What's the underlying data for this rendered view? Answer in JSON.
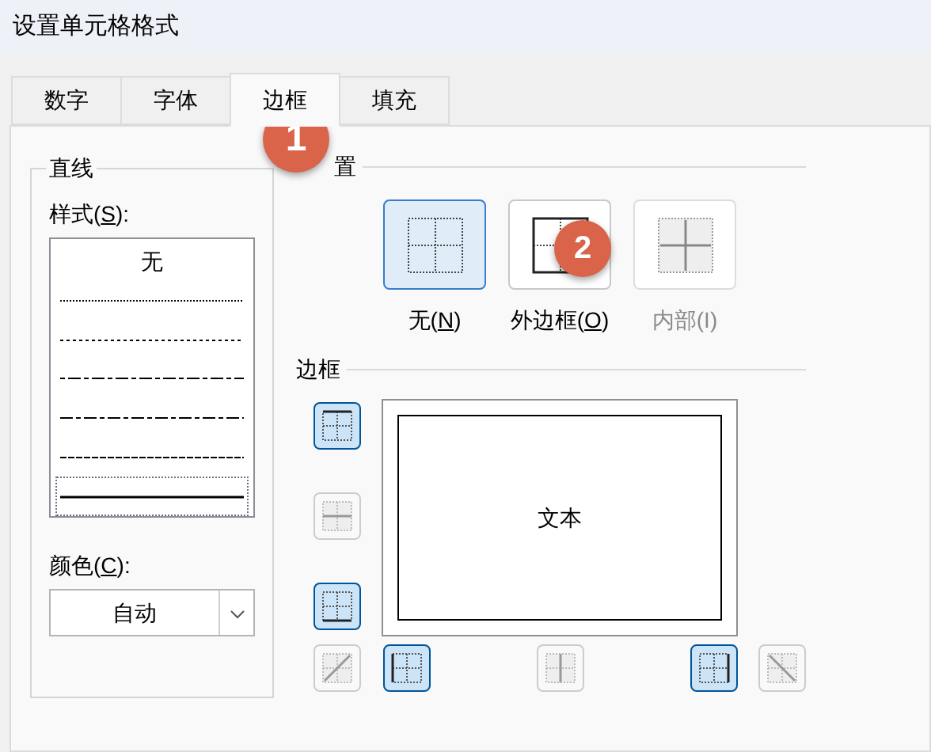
{
  "window": {
    "title": "设置单元格格式"
  },
  "tabs": [
    {
      "label": "数字",
      "selected": false
    },
    {
      "label": "字体",
      "selected": false
    },
    {
      "label": "边框",
      "selected": true
    },
    {
      "label": "填充",
      "selected": false
    }
  ],
  "line_group": {
    "legend": "直线",
    "style_label": {
      "before": "样式(",
      "key": "S",
      "after": "):"
    },
    "styles": [
      {
        "kind": "text",
        "label": "无",
        "selected": false
      },
      {
        "kind": "dotted",
        "selected": false
      },
      {
        "kind": "dashed-fine",
        "selected": false
      },
      {
        "kind": "dash-dot-dot",
        "selected": false
      },
      {
        "kind": "dash-dot",
        "selected": false
      },
      {
        "kind": "dashed",
        "selected": false
      },
      {
        "kind": "solid",
        "selected": true
      }
    ],
    "color_label": {
      "before": "颜色(",
      "key": "C",
      "after": "):"
    },
    "color_value": "自动"
  },
  "presets": {
    "legend": "置",
    "items": [
      {
        "kind": "none",
        "before": "无(",
        "key": "N",
        "after": ")",
        "selected": true,
        "disabled": false
      },
      {
        "kind": "outline",
        "before": "外边框(",
        "key": "O",
        "after": ")",
        "selected": false,
        "disabled": false
      },
      {
        "kind": "inside",
        "before": "内部(I)",
        "selected": false,
        "disabled": true
      }
    ]
  },
  "border": {
    "legend": "边框",
    "preview_text": "文本",
    "left_column": [
      {
        "kind": "top",
        "selected": true,
        "disabled": false
      },
      {
        "kind": "middle-h",
        "selected": false,
        "disabled": true
      },
      {
        "kind": "bottom",
        "selected": true,
        "disabled": false
      }
    ],
    "bottom_row": [
      {
        "kind": "diag-up",
        "selected": false,
        "disabled": true
      },
      {
        "kind": "left",
        "selected": true,
        "disabled": false
      },
      {
        "kind": "middle-v",
        "selected": false,
        "disabled": true
      },
      {
        "kind": "right",
        "selected": true,
        "disabled": false
      },
      {
        "kind": "diag-down",
        "selected": false,
        "disabled": true
      }
    ]
  },
  "badges": [
    {
      "number": "1"
    },
    {
      "number": "2"
    }
  ]
}
